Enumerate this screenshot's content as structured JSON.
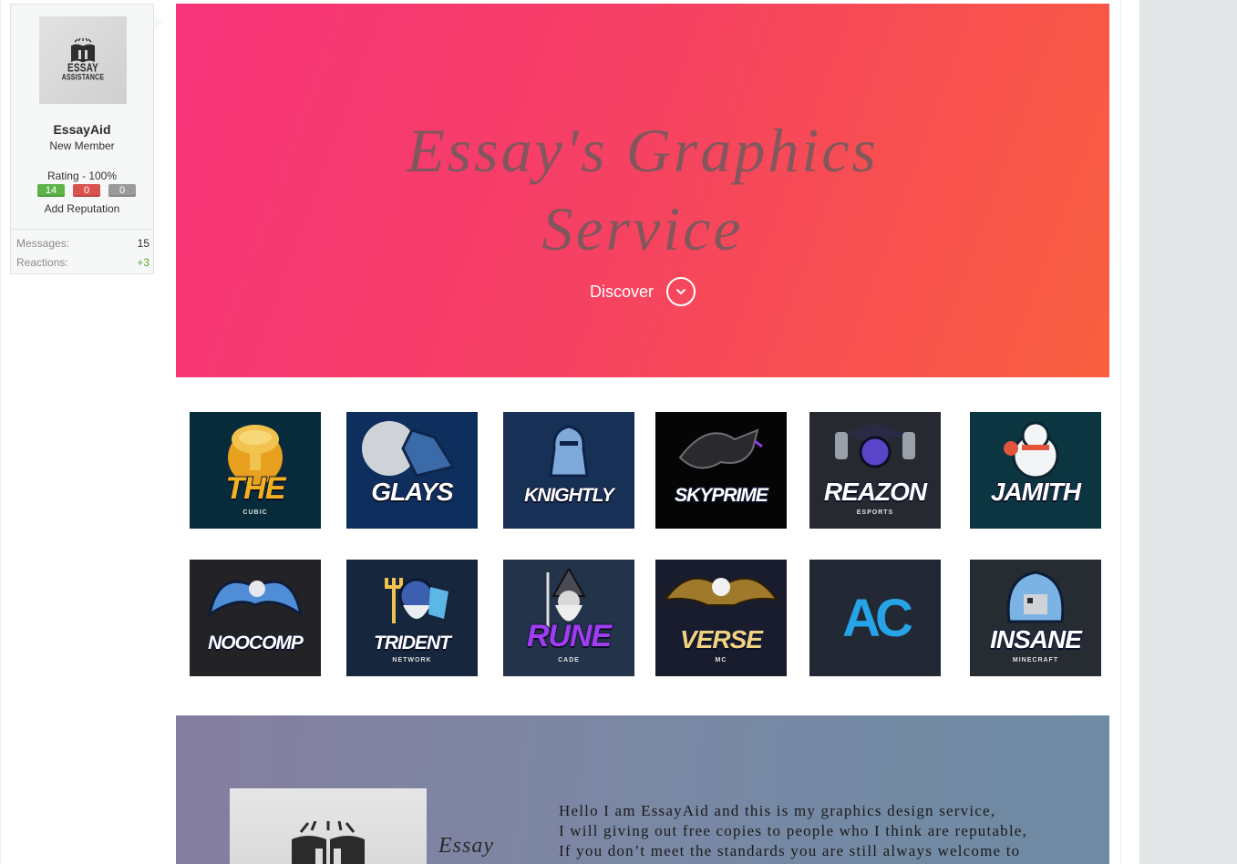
{
  "user_card": {
    "avatar": {
      "line1": "ESSAY",
      "line2": "ASSISTANCE"
    },
    "username": "EssayAid",
    "user_title": "New Member",
    "rating_label": "Rating - 100%",
    "reputation": {
      "positive": "14",
      "negative": "0",
      "neutral": "0"
    },
    "add_reputation_label": "Add Reputation",
    "stats": [
      {
        "label": "Messages:",
        "value": "15"
      },
      {
        "label": "Reactions:",
        "value": "+3"
      }
    ],
    "colors": {
      "positive": "#5cb449",
      "negative": "#d9534f",
      "neutral": "#9a9a9a",
      "reactions_value": "#5aa92c"
    }
  },
  "hero": {
    "title_line1": "Essay's Graphics",
    "title_line2": "Service",
    "discover_label": "Discover",
    "gradient": [
      "#f7337a",
      "#f95f3e"
    ]
  },
  "logos": [
    {
      "name": "THE",
      "sub": "CUBIC",
      "bg": "#082b3b",
      "text_color": "#f3b11d",
      "art": "mushroom-cloud"
    },
    {
      "name": "GLAYS",
      "sub": "",
      "bg": "#0e2f5e",
      "text_color": "#ffffff",
      "art": "wolf-moon"
    },
    {
      "name": "KNIGHTLY",
      "sub": "",
      "bg": "#173055",
      "text_color": "#ffffff",
      "art": "knight"
    },
    {
      "name": "SKYPRIME",
      "sub": "",
      "bg": "#050505",
      "text_color": "#ffffff",
      "art": "dragon"
    },
    {
      "name": "REAZON",
      "sub": "ESPORTS",
      "bg": "#262a30",
      "text_color": "#ffffff",
      "art": "cowboy-guns"
    },
    {
      "name": "JAMITH",
      "sub": "",
      "bg": "#0b3541",
      "text_color": "#ffffff",
      "art": "snowman"
    },
    {
      "name": "NOOCOMP",
      "sub": "",
      "bg": "#232325",
      "text_color": "#ffffff",
      "art": "griffin"
    },
    {
      "name": "TRIDENT",
      "sub": "NETWORK",
      "bg": "#15263d",
      "text_color": "#ffffff",
      "art": "poseidon"
    },
    {
      "name": "RUNE",
      "sub": "CADE",
      "bg": "#22334a",
      "text_color": "#a23cf0",
      "art": "wizard"
    },
    {
      "name": "VERSE",
      "sub": "MC",
      "bg": "#181c2c",
      "text_color": "#f1d27e",
      "art": "eagle"
    },
    {
      "name": "",
      "sub": "",
      "bg": "#222934",
      "text_color": "#27a3e8",
      "art": "ac-monogram",
      "monogram": "AC"
    },
    {
      "name": "INSANE",
      "sub": "MINECRAFT",
      "bg": "#272c33",
      "text_color": "#ffffff",
      "art": "hooded-figure"
    }
  ],
  "about": {
    "logo_label": "Essay",
    "lines": [
      "Hello I am EssayAid and this is my graphics design service,",
      "I will giving out free copies to people who I think are reputable,",
      "If you don’t meet the standards you are still always welcome to"
    ]
  }
}
